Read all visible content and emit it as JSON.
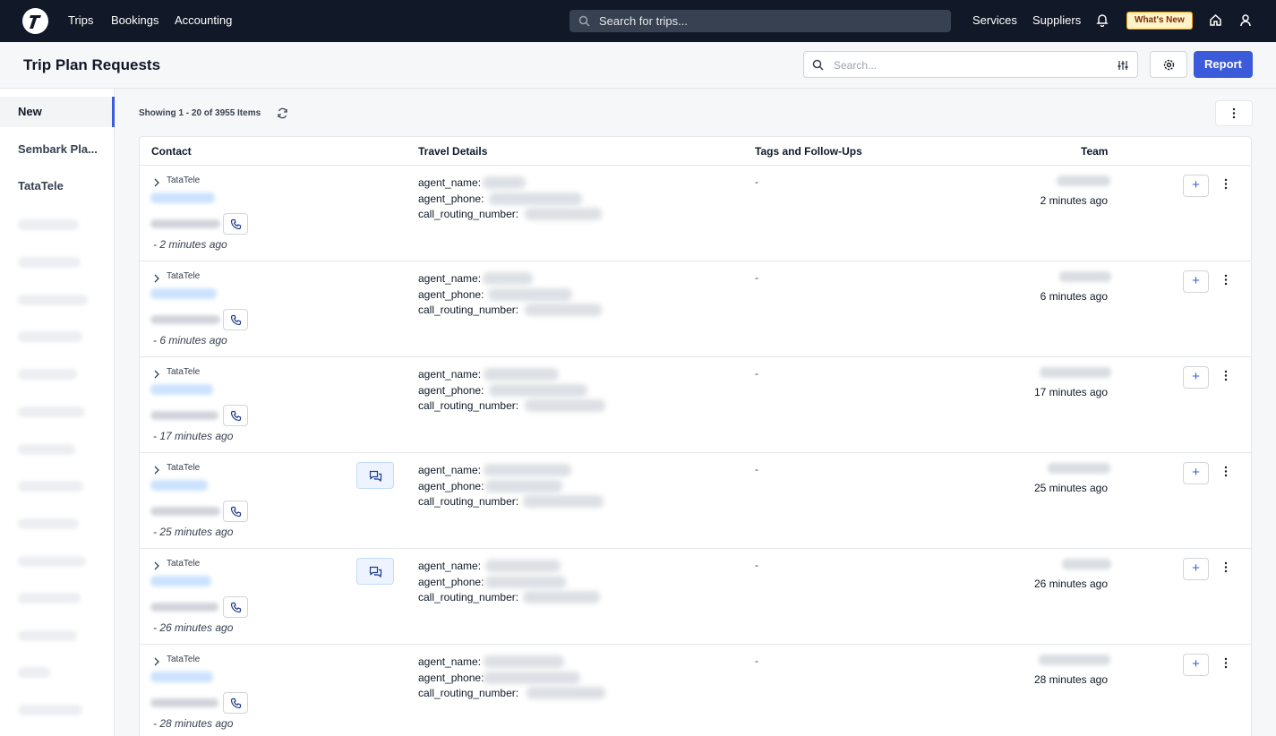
{
  "nav": {
    "links": [
      "Trips",
      "Bookings",
      "Accounting"
    ],
    "search_placeholder": "Search for trips...",
    "right_links": [
      "Services",
      "Suppliers"
    ],
    "whats_new": "What's New"
  },
  "header": {
    "title": "Trip Plan Requests",
    "search_placeholder": "Search...",
    "report_label": "Report"
  },
  "sidebar": {
    "items": [
      "New",
      "Sembark Pla...",
      "TataTele"
    ]
  },
  "content": {
    "showing": "Showing 1 - 20 of 3955 Items"
  },
  "table": {
    "columns": [
      "Contact",
      "Travel Details",
      "Tags and Follow-Ups",
      "Team"
    ],
    "field_labels": [
      "agent_name:",
      "agent_phone:",
      "call_routing_number:"
    ],
    "rows": [
      {
        "source": "TataTele",
        "contact_ago": "- 2 minutes ago",
        "tags": "-",
        "team_ago": "2 minutes ago",
        "has_chat": false
      },
      {
        "source": "TataTele",
        "contact_ago": "- 6 minutes ago",
        "tags": "-",
        "team_ago": "6 minutes ago",
        "has_chat": false
      },
      {
        "source": "TataTele",
        "contact_ago": "- 17 minutes ago",
        "tags": "-",
        "team_ago": "17 minutes ago",
        "has_chat": false
      },
      {
        "source": "TataTele",
        "contact_ago": "- 25 minutes ago",
        "tags": "-",
        "team_ago": "25 minutes ago",
        "has_chat": true
      },
      {
        "source": "TataTele",
        "contact_ago": "- 26 minutes ago",
        "tags": "-",
        "team_ago": "26 minutes ago",
        "has_chat": true
      },
      {
        "source": "TataTele",
        "contact_ago": "- 28 minutes ago",
        "tags": "-",
        "team_ago": "28 minutes ago",
        "has_chat": false
      }
    ]
  }
}
